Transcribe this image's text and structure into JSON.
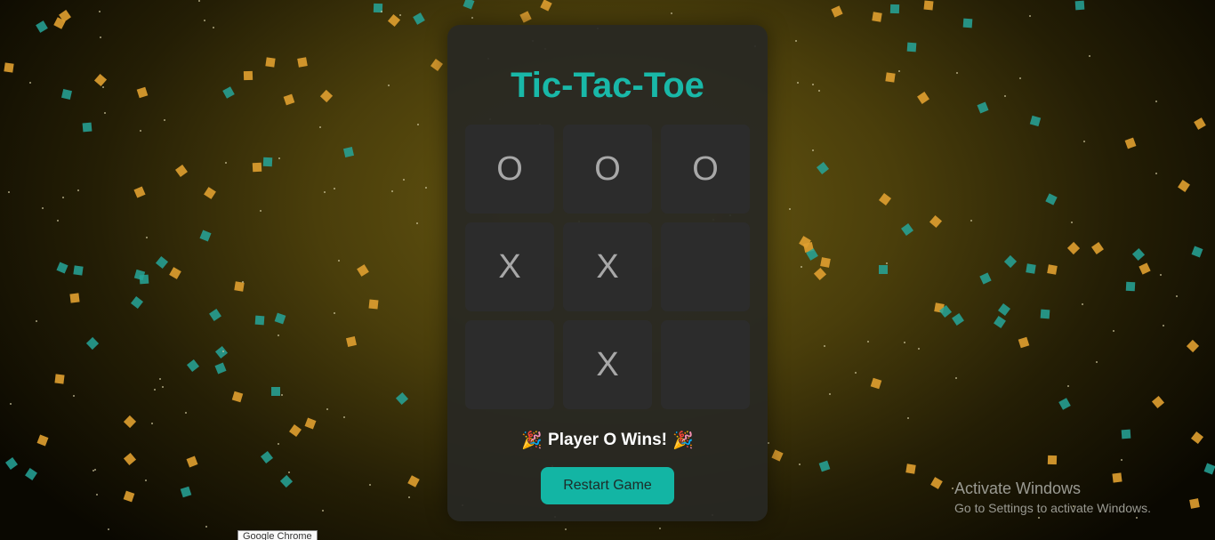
{
  "game": {
    "title": "Tic-Tac-Toe",
    "board": [
      "O",
      "O",
      "O",
      "X",
      "X",
      "",
      "",
      "X",
      ""
    ],
    "status_text": "Player O Wins!",
    "status_emoji": "🎉",
    "restart_label": "Restart Game"
  },
  "overlay": {
    "activate_title": "Activate Windows",
    "activate_subtitle": "Go to Settings to activate Windows."
  },
  "taskbar_tooltip": "Google Chrome",
  "colors": {
    "title": "#19b8a8",
    "button": "#13b5a4",
    "confetti_teal": "#26a69a",
    "confetti_gold": "#e0a030"
  }
}
